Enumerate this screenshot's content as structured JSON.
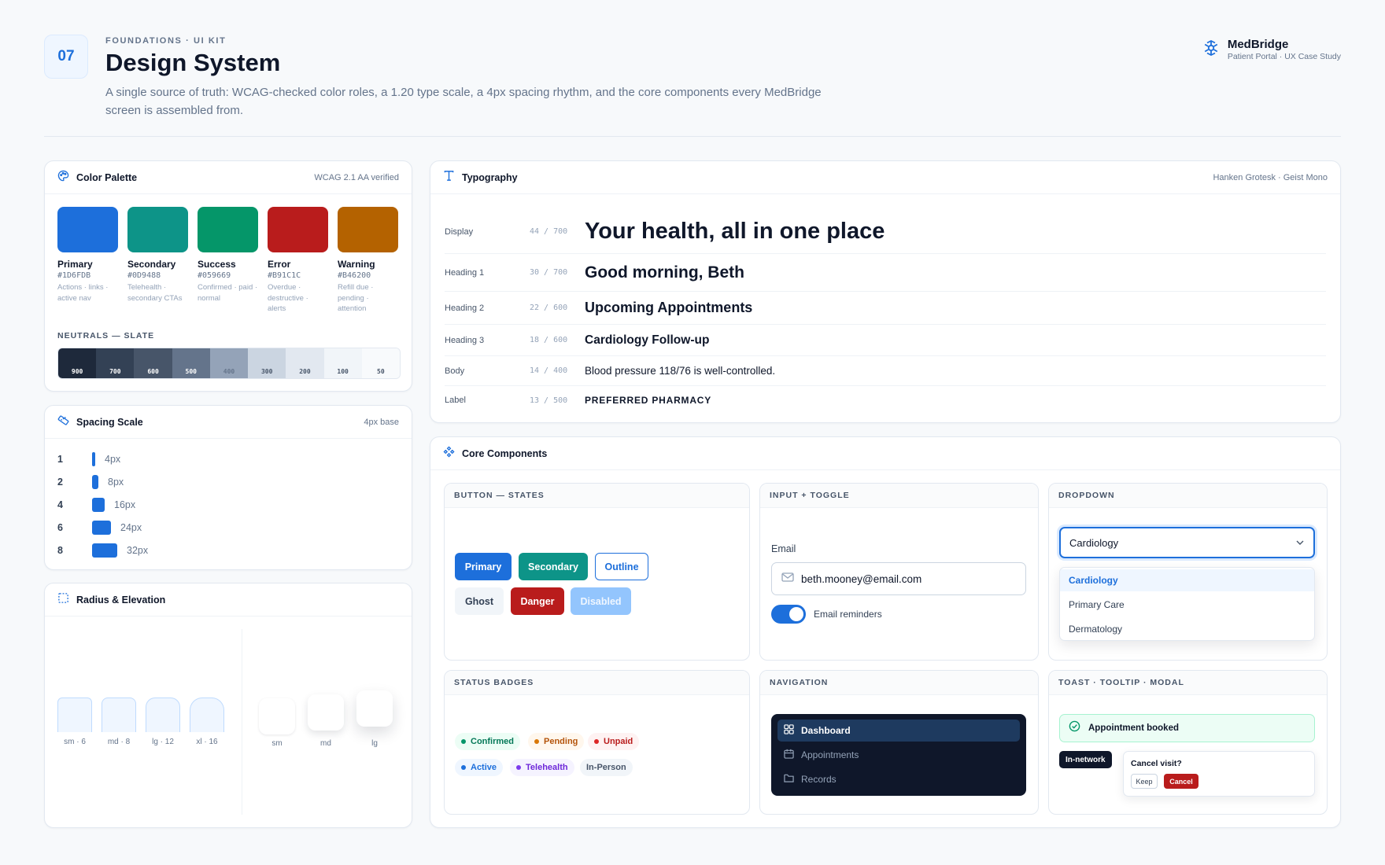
{
  "header": {
    "number": "07",
    "eyebrow": "FOUNDATIONS · UI KIT",
    "title": "Design System",
    "subtitle": "A single source of truth: WCAG-checked color roles, a 1.20 type scale, a 4px spacing rhythm, and the core components every MedBridge screen is assembled from.",
    "brand_name": "MedBridge",
    "brand_sub": "Patient Portal · UX Case Study"
  },
  "palette": {
    "title": "Color Palette",
    "meta": "WCAG 2.1 AA verified",
    "swatches": [
      {
        "name": "Primary",
        "hex": "#1D6FDB",
        "desc": "Actions · links · active nav"
      },
      {
        "name": "Secondary",
        "hex": "#0D9488",
        "desc": "Telehealth · secondary CTAs"
      },
      {
        "name": "Success",
        "hex": "#059669",
        "desc": "Confirmed · paid · normal"
      },
      {
        "name": "Error",
        "hex": "#B91C1C",
        "desc": "Overdue · destructive · alerts"
      },
      {
        "name": "Warning",
        "hex": "#B46200",
        "desc": "Refill due · pending · attention"
      }
    ],
    "neutrals_label": "NEUTRALS — SLATE",
    "neutrals": [
      {
        "label": "900",
        "color": "#1E293B",
        "text": "#FFFFFF"
      },
      {
        "label": "700",
        "color": "#334155",
        "text": "#FFFFFF"
      },
      {
        "label": "600",
        "color": "#475569",
        "text": "#FFFFFF"
      },
      {
        "label": "500",
        "color": "#64748B",
        "text": "#FFFFFF"
      },
      {
        "label": "400",
        "color": "#94A3B8",
        "text": "#64748B"
      },
      {
        "label": "300",
        "color": "#CBD5E1",
        "text": "#475569"
      },
      {
        "label": "200",
        "color": "#E2E8F0",
        "text": "#475569"
      },
      {
        "label": "100",
        "color": "#F1F5F9",
        "text": "#475569"
      },
      {
        "label": "50",
        "color": "#F8FAFC",
        "text": "#475569"
      }
    ]
  },
  "spacing": {
    "title": "Spacing Scale",
    "meta": "4px base",
    "rows": [
      {
        "key": "1",
        "value": "4px"
      },
      {
        "key": "2",
        "value": "8px"
      },
      {
        "key": "4",
        "value": "16px"
      },
      {
        "key": "6",
        "value": "24px"
      },
      {
        "key": "8",
        "value": "32px"
      }
    ]
  },
  "radius": {
    "title": "Radius & Elevation",
    "radii": [
      "sm · 6",
      "md · 8",
      "lg · 12",
      "xl · 16"
    ],
    "elevations": [
      "sm",
      "md",
      "lg"
    ]
  },
  "typography": {
    "title": "Typography",
    "meta": "Hanken Grotesk · Geist Mono",
    "rows": [
      {
        "role": "Display",
        "spec": "44 / 700",
        "sample": "Your health, all in one place"
      },
      {
        "role": "Heading 1",
        "spec": "30 / 700",
        "sample": "Good morning, Beth"
      },
      {
        "role": "Heading 2",
        "spec": "22 / 600",
        "sample": "Upcoming Appointments"
      },
      {
        "role": "Heading 3",
        "spec": "18 / 600",
        "sample": "Cardiology Follow-up"
      },
      {
        "role": "Body",
        "spec": "14 / 400",
        "sample": "Blood pressure 118/76 is well-controlled."
      },
      {
        "role": "Label",
        "spec": "13 / 500",
        "sample": "PREFERRED PHARMACY"
      }
    ]
  },
  "components": {
    "title": "Core Components",
    "buttons": {
      "heading": "BUTTON — STATES",
      "primary": "Primary",
      "secondary": "Secondary",
      "outline": "Outline",
      "ghost": "Ghost",
      "danger": "Danger",
      "disabled": "Disabled"
    },
    "input": {
      "heading": "INPUT + TOGGLE",
      "label": "Email",
      "value": "beth.mooney@email.com",
      "toggle_label": "Email reminders",
      "toggle_on": true
    },
    "dropdown": {
      "heading": "DROPDOWN",
      "selected": "Cardiology",
      "options": [
        "Cardiology",
        "Primary Care",
        "Dermatology"
      ]
    },
    "badges": {
      "heading": "STATUS BADGES",
      "items": [
        "Confirmed",
        "Pending",
        "Unpaid",
        "Active",
        "Telehealth",
        "In-Person"
      ]
    },
    "navigation": {
      "heading": "NAVIGATION",
      "items": [
        "Dashboard",
        "Appointments",
        "Records"
      ]
    },
    "feedback": {
      "heading": "TOAST · TOOLTIP · MODAL",
      "toast": "Appointment booked",
      "tooltip": "In-network",
      "modal_title": "Cancel visit?",
      "keep": "Keep",
      "cancel": "Cancel"
    }
  }
}
